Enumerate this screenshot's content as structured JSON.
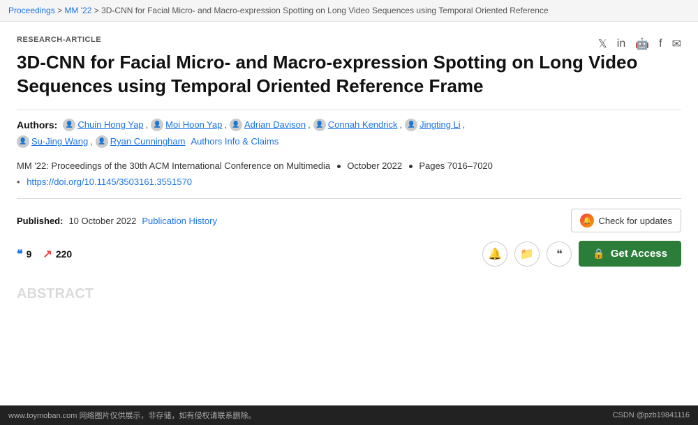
{
  "breadcrumb": {
    "items": [
      {
        "label": "Proceedings",
        "href": "#"
      },
      {
        "label": "MM '22",
        "href": "#"
      },
      {
        "label": "3D-CNN for Facial Micro- and Macro-expression Spotting on Long Video Sequences using Temporal Oriented Reference"
      }
    ],
    "separator": ">"
  },
  "article": {
    "type_label": "RESEARCH-ARTICLE",
    "title": "3D-CNN for Facial Micro- and Macro-expression Spotting on Long Video Sequences using Temporal Oriented Reference Frame",
    "authors_label": "Authors:",
    "authors": [
      {
        "name": "Chuin Hong Yap"
      },
      {
        "name": "Moi Hoon Yap"
      },
      {
        "name": "Adrian Davison"
      },
      {
        "name": "Connah Kendrick"
      },
      {
        "name": "Jingting Li"
      },
      {
        "name": "Su-Jing Wang"
      },
      {
        "name": "Ryan Cunningham"
      }
    ],
    "authors_info_label": "Authors Info & Claims",
    "conference_line": "MM '22: Proceedings of the 30th ACM International Conference on Multimedia",
    "date_label": "October 2022",
    "pages_label": "Pages 7016–7020",
    "doi_prefix": "• https://doi.org/",
    "doi_value": "10.1145/3503161.3551570",
    "published_label": "Published:",
    "published_date": "10 October 2022",
    "publication_history_label": "Publication History",
    "check_updates_label": "Check for updates",
    "citations_count": "9",
    "reads_count": "220",
    "get_access_label": "Get Access"
  },
  "social": {
    "icons": [
      "twitter",
      "linkedin",
      "reddit",
      "facebook",
      "email"
    ]
  },
  "watermark": {
    "left": "www.toymoban.com 网络图片仅供展示，非存储，如有侵权请联系删除。",
    "right": "CSDN @pzb19841116"
  },
  "abstract_hint": "ABSTRACT"
}
